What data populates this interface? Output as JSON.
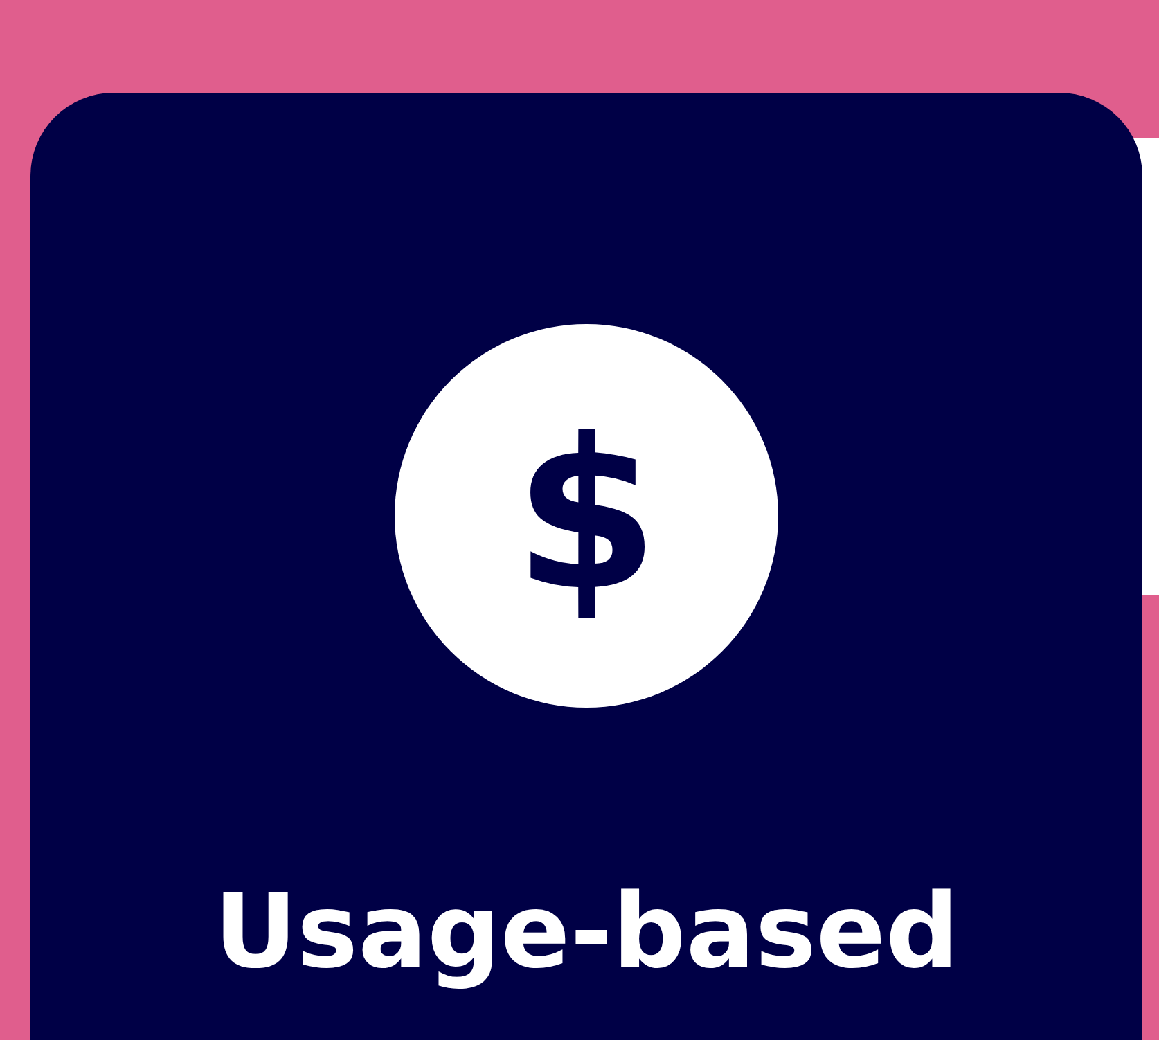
{
  "card": {
    "icon_glyph": "$",
    "title": "Usage-based"
  }
}
